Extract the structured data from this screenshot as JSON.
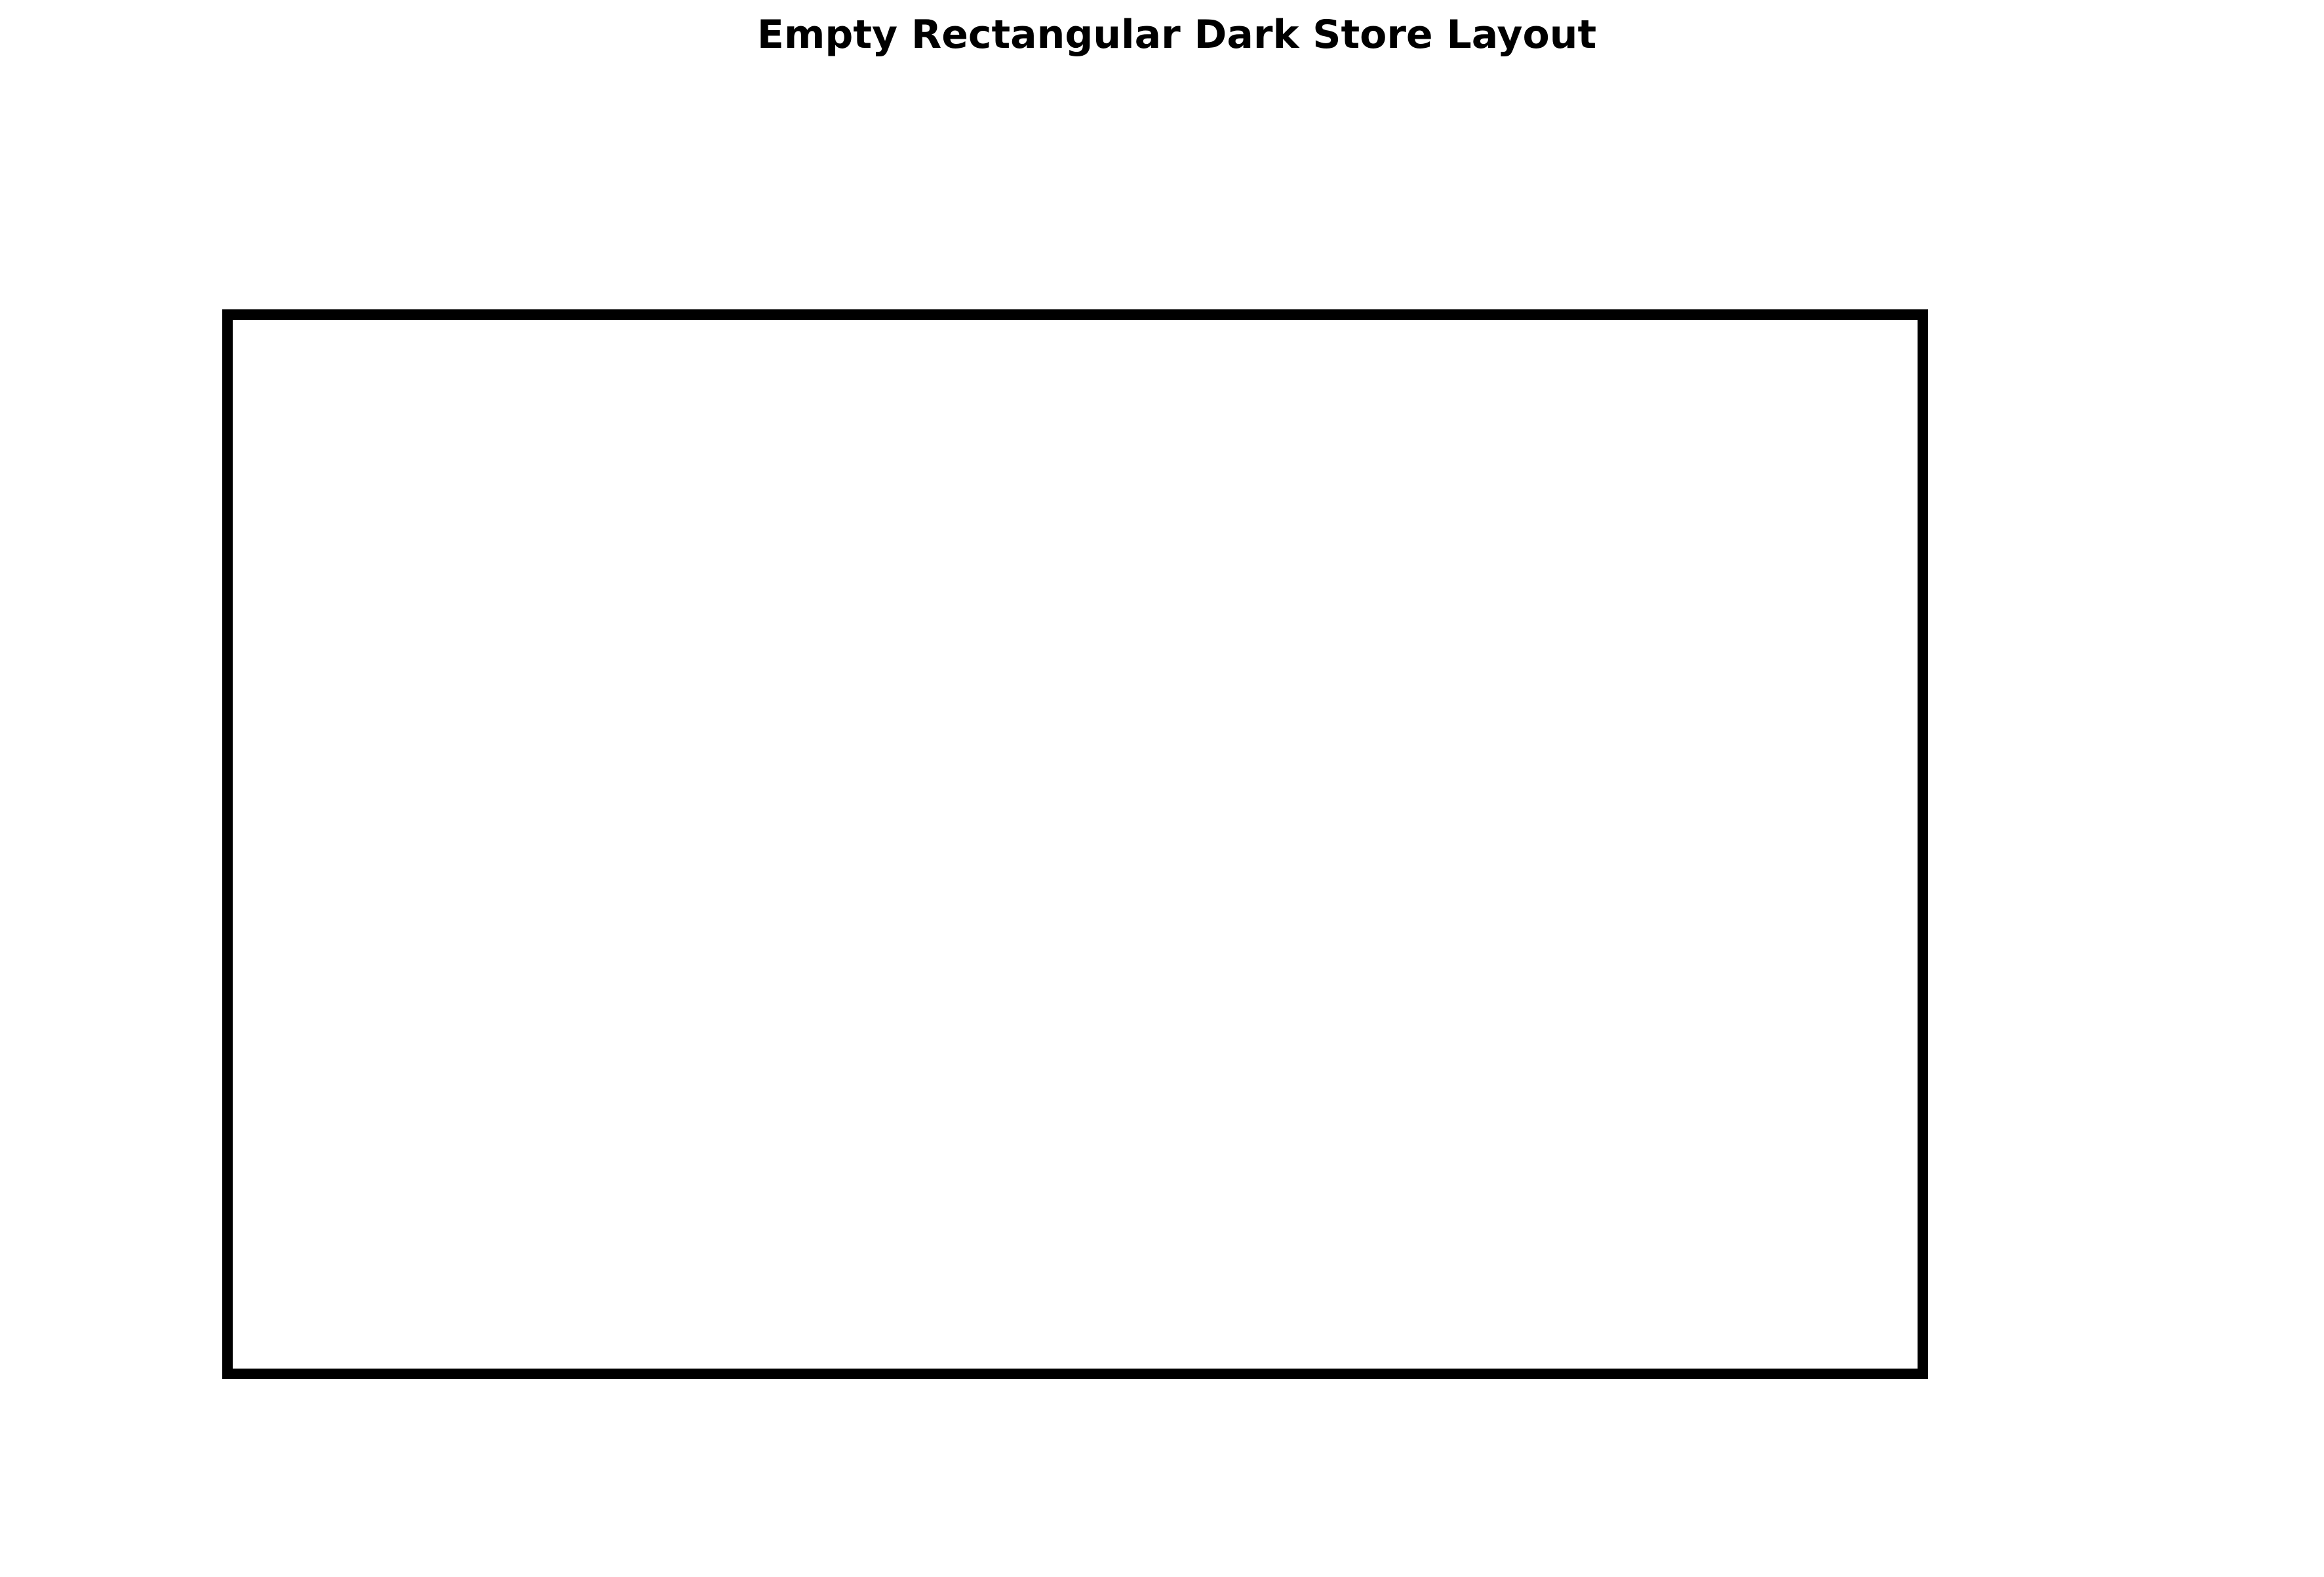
{
  "title": "Empty Rectangular Dark Store Layout",
  "colors": {
    "outline": "#000000",
    "background": "#ffffff"
  }
}
